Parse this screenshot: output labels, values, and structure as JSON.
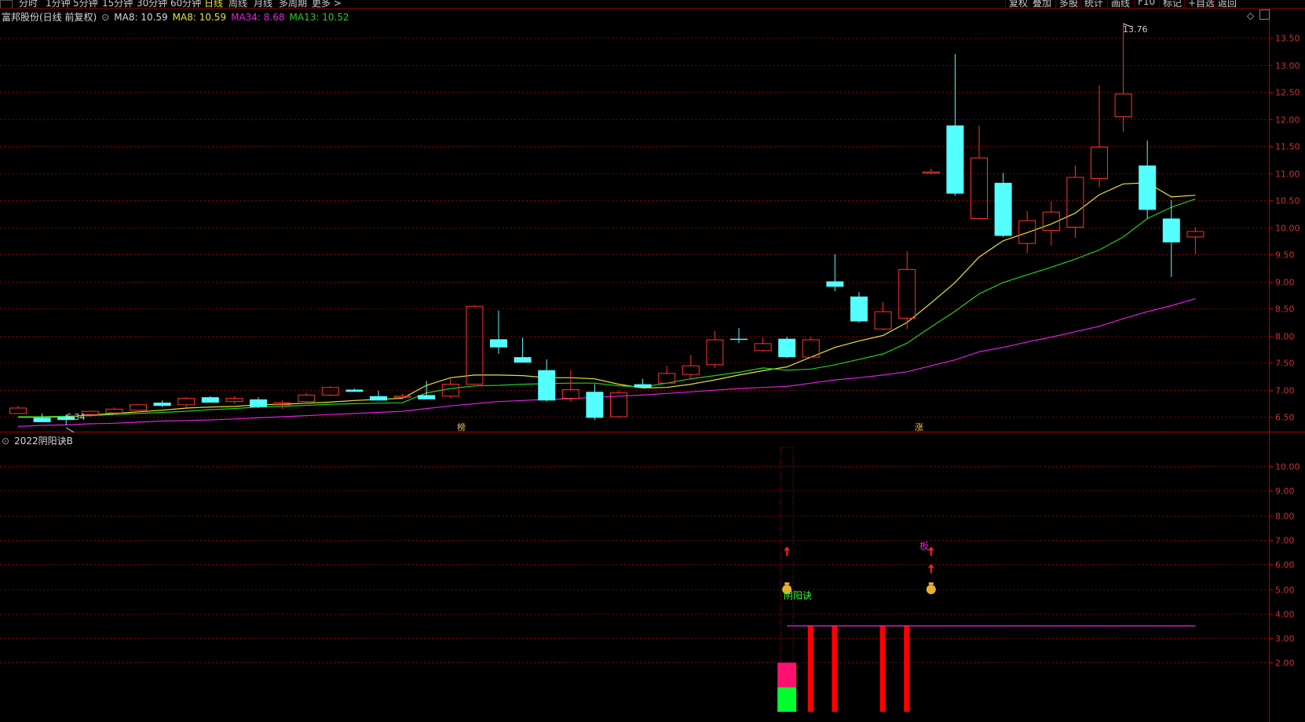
{
  "toolbar": {
    "period_tabs": [
      "分时",
      "1分钟",
      "5分钟",
      "15分钟",
      "30分钟",
      "60分钟",
      "日线",
      "周线",
      "月线",
      "多周期",
      "更多 >"
    ],
    "active_tab": "日线",
    "right_buttons": [
      "复权",
      "叠加",
      "多股",
      "统计",
      "画线",
      "F10",
      "标记",
      "+自选",
      "返回"
    ]
  },
  "main_chart": {
    "stock_name": "富邦股份(日线 前复权)",
    "ma_label": "MA8: 10.59",
    "ma8": "MA8: 10.59",
    "ma34": "MA34: 8.68",
    "ma13": "MA13: 10.52",
    "high_label": "13.76",
    "low_label": "6.34",
    "markers": [
      "榜",
      "涨"
    ],
    "price_ticks": [
      "13.50",
      "13.00",
      "12.50",
      "12.00",
      "11.50",
      "11.00",
      "10.50",
      "10.00",
      "9.50",
      "9.00",
      "8.50",
      "8.00",
      "7.50",
      "7.00",
      "6.50"
    ]
  },
  "sub_chart": {
    "indicator_name": "2022阴阳诀B",
    "signal_text": "阴阳诀",
    "board_text": "板",
    "ticks": [
      "10.00",
      "9.00",
      "8.00",
      "7.00",
      "6.00",
      "5.00",
      "4.00",
      "3.00",
      "2.00"
    ]
  },
  "colors": {
    "up": "#ff3232",
    "down": "#54ffff",
    "ma8": "#e8e23a",
    "ma13": "#20d020",
    "ma34": "#e020e0",
    "grid": "#7a0000",
    "bar_red": "#ff0000",
    "bar_pink": "#ff1070",
    "bar_green": "#00ff30"
  },
  "chart_data": [
    {
      "type": "candlestick",
      "series": [
        {
          "name": "MA8",
          "values": [
            6.49,
            6.49,
            6.5,
            6.53,
            6.56,
            6.59,
            6.62,
            6.66,
            6.68,
            6.69,
            6.72,
            6.73,
            6.75,
            6.77,
            6.8,
            6.82,
            6.84,
            7.08,
            7.22,
            7.27,
            7.27,
            7.26,
            7.22,
            7.22,
            7.2,
            7.1,
            7.03,
            7.04,
            7.1,
            7.18,
            7.27,
            7.35,
            7.42,
            7.6,
            7.78,
            7.9,
            8.0,
            8.24,
            8.6,
            8.98,
            9.45,
            9.75,
            9.9,
            10.06,
            10.26,
            10.6,
            10.8,
            10.82,
            10.56,
            10.59
          ]
        },
        {
          "name": "MA13",
          "values": [
            6.5,
            6.5,
            6.51,
            6.52,
            6.54,
            6.56,
            6.58,
            6.6,
            6.63,
            6.65,
            6.68,
            6.69,
            6.71,
            6.73,
            6.74,
            6.75,
            6.76,
            6.94,
            7.02,
            7.07,
            7.08,
            7.1,
            7.11,
            7.12,
            7.12,
            7.07,
            7.05,
            7.12,
            7.2,
            7.26,
            7.32,
            7.4,
            7.36,
            7.38,
            7.46,
            7.56,
            7.66,
            7.86,
            8.16,
            8.45,
            8.77,
            8.98,
            9.12,
            9.26,
            9.41,
            9.58,
            9.82,
            10.16,
            10.37,
            10.52
          ]
        },
        {
          "name": "MA34",
          "values": [
            6.32,
            6.34,
            6.35,
            6.37,
            6.38,
            6.4,
            6.42,
            6.43,
            6.44,
            6.46,
            6.48,
            6.5,
            6.52,
            6.54,
            6.56,
            6.58,
            6.6,
            6.65,
            6.7,
            6.74,
            6.78,
            6.8,
            6.82,
            6.83,
            6.86,
            6.88,
            6.9,
            6.93,
            6.96,
            6.99,
            7.02,
            7.04,
            7.06,
            7.12,
            7.18,
            7.22,
            7.27,
            7.33,
            7.44,
            7.55,
            7.7,
            7.78,
            7.88,
            7.97,
            8.07,
            8.17,
            8.31,
            8.44,
            8.55,
            8.68
          ]
        }
      ],
      "ohlc": [
        [
          6.56,
          6.7,
          6.55,
          6.66
        ],
        [
          6.48,
          6.56,
          6.4,
          6.4
        ],
        [
          6.5,
          6.54,
          6.34,
          6.44
        ],
        [
          6.54,
          6.6,
          6.5,
          6.6
        ],
        [
          6.57,
          6.67,
          6.53,
          6.64
        ],
        [
          6.62,
          6.74,
          6.58,
          6.72
        ],
        [
          6.76,
          6.8,
          6.68,
          6.7
        ],
        [
          6.72,
          6.86,
          6.68,
          6.84
        ],
        [
          6.86,
          6.88,
          6.78,
          6.76
        ],
        [
          6.78,
          6.88,
          6.74,
          6.84
        ],
        [
          6.82,
          6.86,
          6.66,
          6.68
        ],
        [
          6.72,
          6.8,
          6.64,
          6.76
        ],
        [
          6.78,
          6.94,
          6.74,
          6.9
        ],
        [
          6.9,
          7.06,
          6.88,
          7.04
        ],
        [
          7.0,
          7.02,
          6.96,
          6.96
        ],
        [
          6.88,
          6.98,
          6.8,
          6.8
        ],
        [
          6.86,
          6.92,
          6.84,
          6.88
        ],
        [
          6.9,
          7.16,
          6.82,
          6.82
        ],
        [
          6.88,
          7.2,
          6.84,
          7.1
        ],
        [
          7.1,
          8.56,
          7.1,
          8.54
        ],
        [
          7.93,
          8.46,
          7.66,
          7.78
        ],
        [
          7.6,
          7.96,
          7.5,
          7.5
        ],
        [
          7.36,
          7.56,
          6.78,
          6.8
        ],
        [
          6.84,
          7.36,
          6.78,
          7.0
        ],
        [
          6.96,
          7.1,
          6.44,
          6.48
        ],
        [
          6.5,
          6.98,
          6.48,
          6.94
        ],
        [
          7.1,
          7.2,
          7.04,
          7.04
        ],
        [
          7.12,
          7.44,
          7.1,
          7.3
        ],
        [
          7.28,
          7.64,
          7.18,
          7.44
        ],
        [
          7.46,
          8.08,
          7.4,
          7.92
        ],
        [
          7.94,
          8.14,
          7.86,
          7.92
        ],
        [
          7.72,
          7.96,
          7.7,
          7.85
        ],
        [
          7.94,
          7.98,
          7.58,
          7.6
        ],
        [
          7.6,
          7.98,
          7.58,
          7.92
        ],
        [
          9.0,
          9.5,
          8.82,
          8.9
        ],
        [
          8.72,
          8.8,
          8.24,
          8.26
        ],
        [
          8.12,
          8.62,
          8.1,
          8.44
        ],
        [
          8.32,
          9.56,
          8.12,
          9.22
        ],
        [
          11.0,
          11.08,
          10.98,
          11.02
        ],
        [
          11.88,
          13.2,
          10.58,
          10.62
        ],
        [
          10.16,
          11.88,
          10.14,
          11.28
        ],
        [
          10.82,
          11.0,
          9.82,
          9.84
        ],
        [
          9.7,
          10.3,
          9.52,
          10.12
        ],
        [
          9.94,
          10.48,
          9.66,
          10.28
        ],
        [
          10.0,
          11.14,
          9.8,
          10.92
        ],
        [
          10.9,
          12.62,
          10.74,
          11.48
        ],
        [
          12.04,
          13.76,
          11.76,
          12.46
        ],
        [
          11.14,
          11.6,
          10.16,
          10.32
        ],
        [
          10.16,
          10.5,
          9.08,
          9.72
        ],
        [
          9.82,
          10.0,
          9.5,
          9.92
        ]
      ],
      "ylim": [
        6.2,
        13.8
      ]
    },
    {
      "type": "bar",
      "title": "2022阴阳诀B",
      "bars": [
        {
          "index": 32,
          "values": [
            1.0,
            1.0
          ]
        },
        {
          "index": 33,
          "value": 3.5
        },
        {
          "index": 34,
          "value": 3.5
        },
        {
          "index": 36,
          "value": 3.5
        },
        {
          "index": 37,
          "value": 3.5
        }
      ],
      "line": {
        "value": 3.5,
        "from": 32,
        "to": 49
      },
      "arrows": [
        {
          "index": 32,
          "value": 6.5
        },
        {
          "index": 38,
          "value": 6.5
        },
        {
          "index": 38,
          "value": 5.8
        }
      ],
      "ylim": [
        0,
        11
      ]
    }
  ]
}
